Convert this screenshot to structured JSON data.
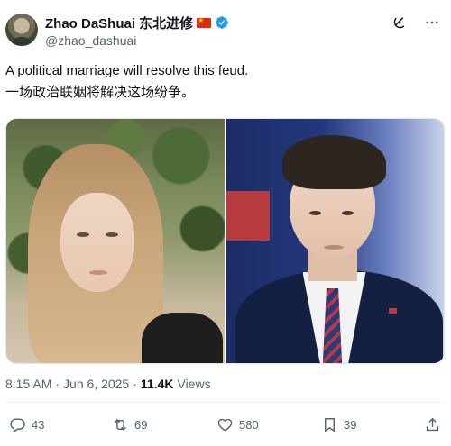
{
  "author": {
    "display_name": "Zhao DaShuai 东北进修",
    "handle": "@zhao_dashuai",
    "flag_icon": "china-flag-icon",
    "verified_icon": "verified-badge-icon",
    "verified_color": "#1d9bf0"
  },
  "header_icons": [
    "grok-icon",
    "more-icon"
  ],
  "tweet": {
    "text_line1": "A political marriage will resolve this feud.",
    "text_line2": "一场政治联姻将解决这场纷争。"
  },
  "media": {
    "count": 2
  },
  "meta": {
    "time": "8:15 AM",
    "separator": "·",
    "date": "Jun 6, 2025",
    "separator2": "·",
    "views_count": "11.4K",
    "views_label": "Views"
  },
  "actions": {
    "reply": {
      "icon": "reply-icon",
      "count": "43"
    },
    "repost": {
      "icon": "repost-icon",
      "count": "69"
    },
    "like": {
      "icon": "like-icon",
      "count": "580"
    },
    "bookmark": {
      "icon": "bookmark-icon",
      "count": "39"
    },
    "share": {
      "icon": "share-icon"
    }
  },
  "colors": {
    "text_primary": "#0f1419",
    "text_secondary": "#536471",
    "accent": "#1d9bf0"
  }
}
